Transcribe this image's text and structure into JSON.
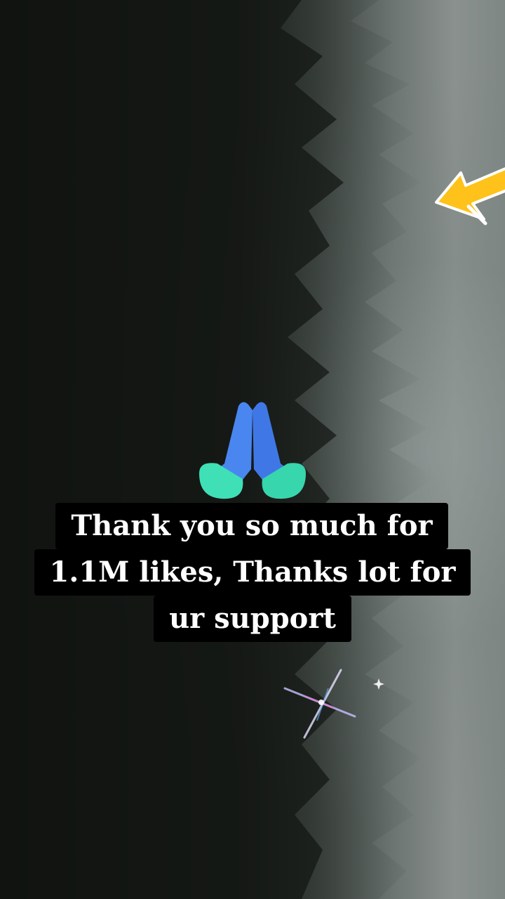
{
  "overlay": {
    "caption_lines": [
      "Thank you so much for",
      "1.1M likes, Thanks lot for",
      "ur support"
    ]
  },
  "icons": {
    "arrow": "yellow-arrow-icon",
    "emoji": "folded-hands-emoji-icon",
    "sparkle": "sparkle-icon"
  },
  "colors": {
    "arrow_fill": "#FFC21A",
    "hands_blue": "#4A86F0",
    "hands_cuff": "#3FE0B6",
    "caption_bg": "#000000",
    "caption_text": "#FFFFFF"
  }
}
